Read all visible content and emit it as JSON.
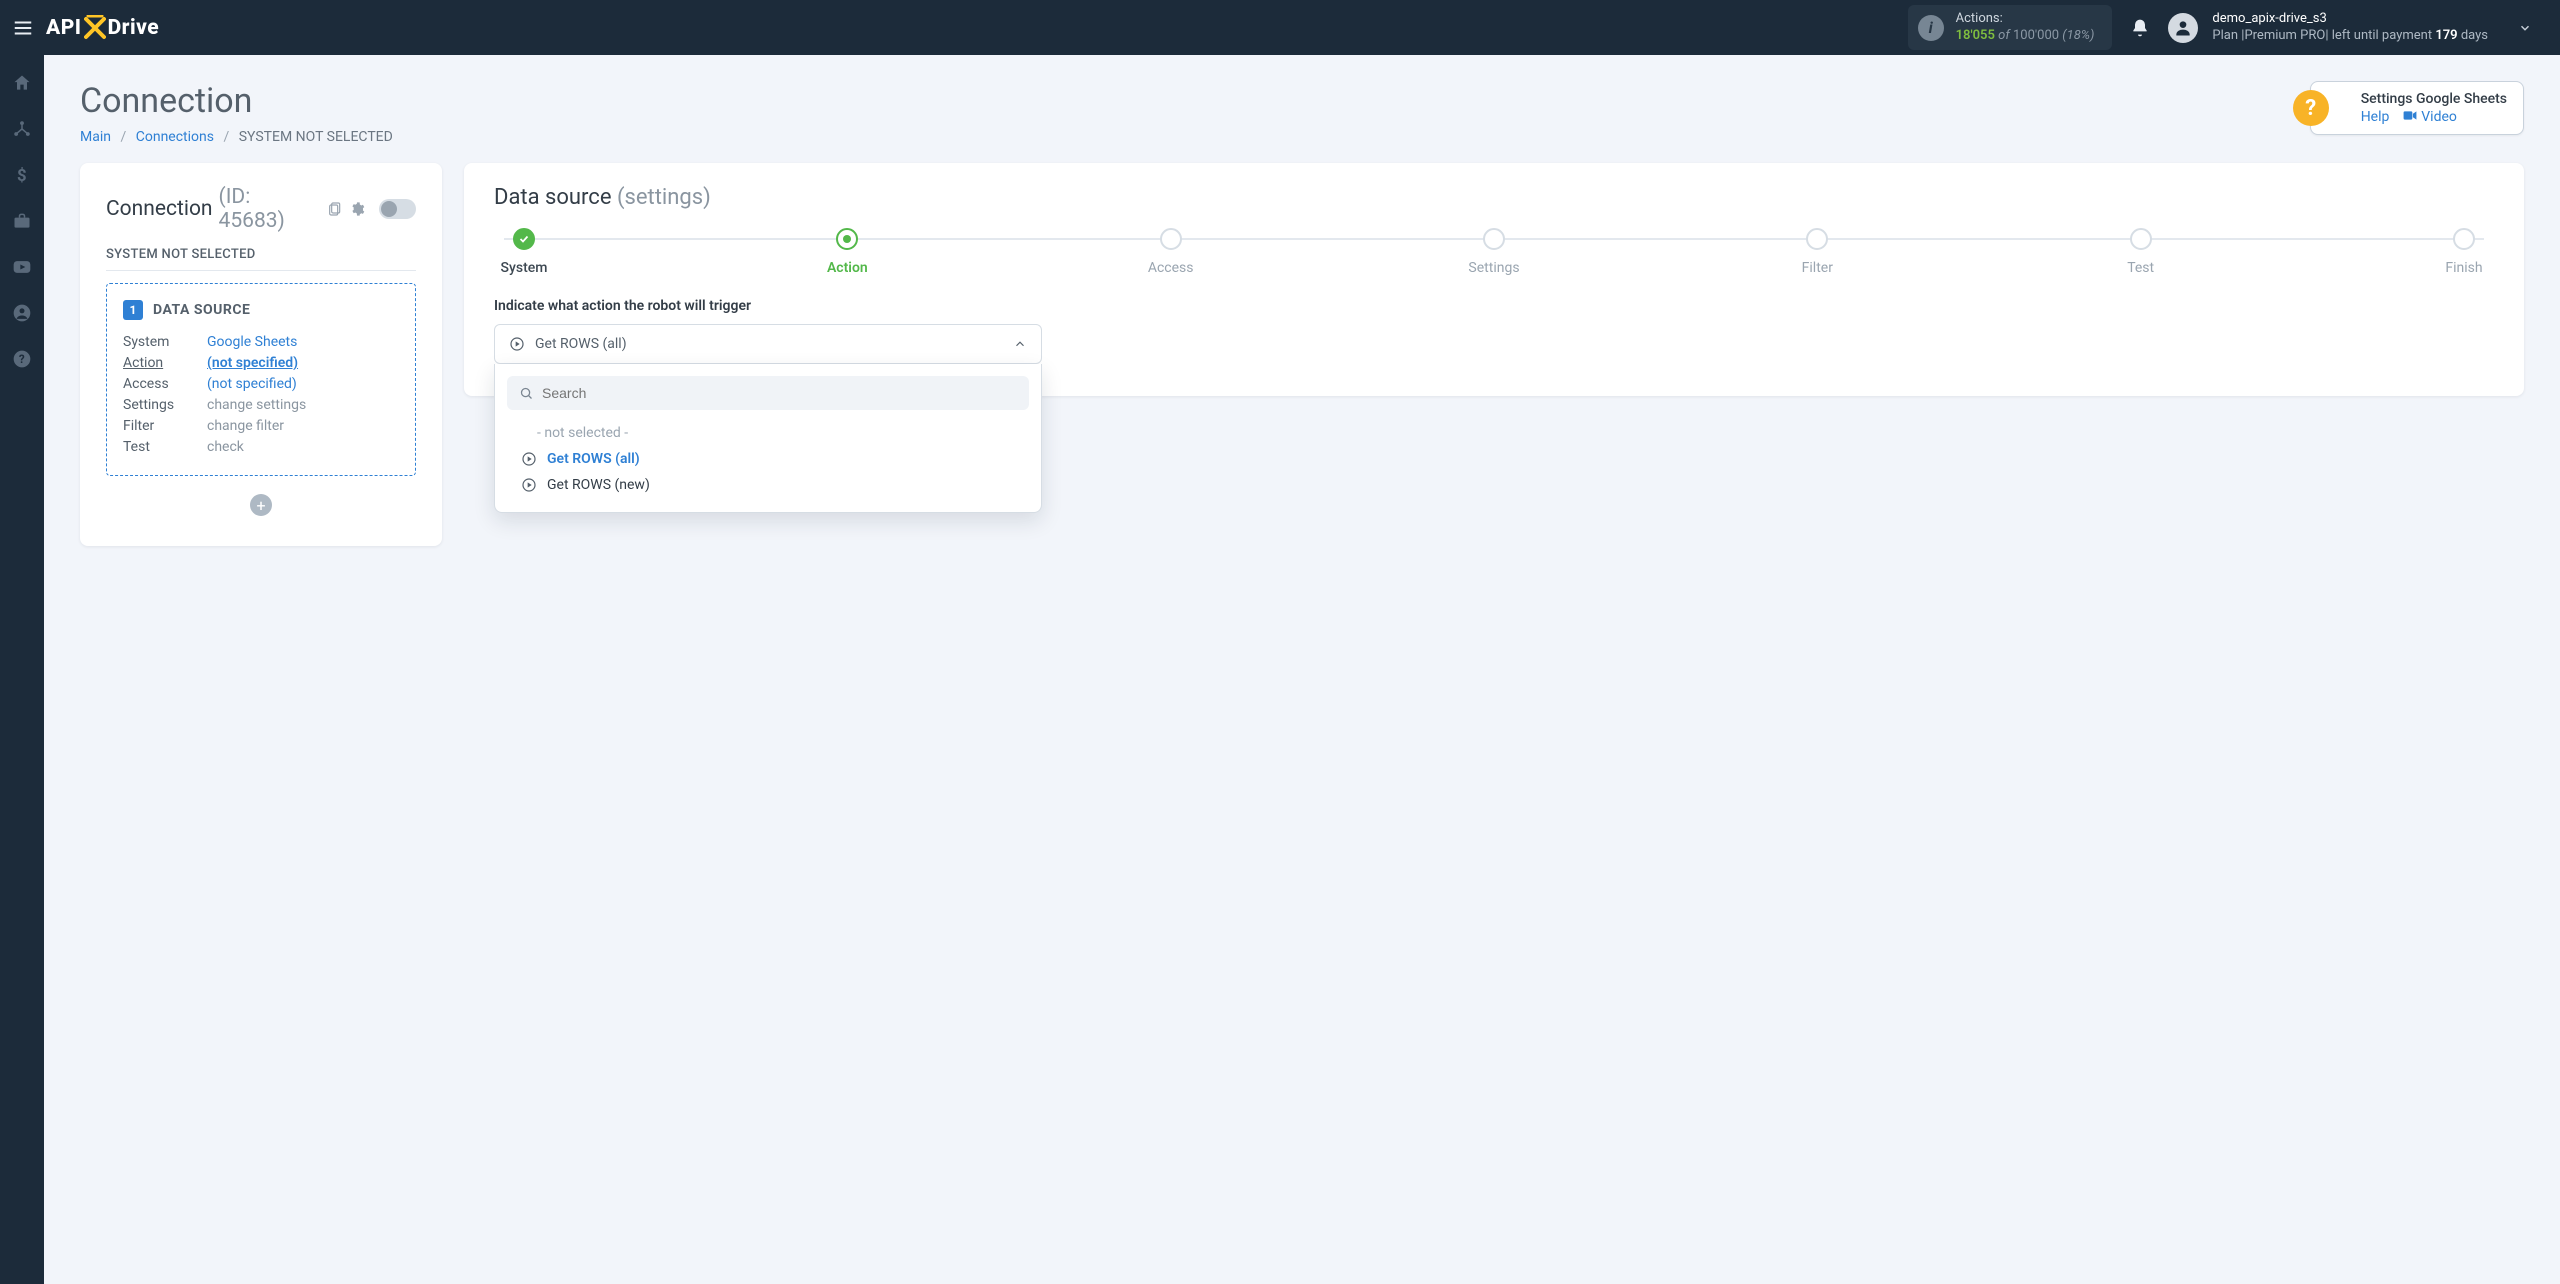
{
  "brand": {
    "part1": "API",
    "part2": "Drive"
  },
  "actions_box": {
    "label": "Actions:",
    "used": "18'055",
    "of": "of",
    "total": "100'000",
    "pct": "(18%)"
  },
  "user": {
    "name": "demo_apix-drive_s3",
    "plan_prefix": "Plan |",
    "plan_name": "Premium PRO",
    "plan_mid": "| left until payment ",
    "days": "179",
    "days_suffix": " days"
  },
  "page": {
    "title": "Connection",
    "breadcrumb": {
      "main": "Main",
      "connections": "Connections",
      "current": "SYSTEM NOT SELECTED"
    }
  },
  "help": {
    "title": "Settings Google Sheets",
    "help_link": "Help",
    "video_link": "Video"
  },
  "left_panel": {
    "title": "Connection",
    "id_label": "(ID: 45683)",
    "subhead": "SYSTEM NOT SELECTED",
    "data_source_label": "DATA SOURCE",
    "badge": "1",
    "rows": {
      "system_k": "System",
      "system_v": "Google Sheets",
      "action_k": "Action",
      "action_v": "(not specified)",
      "access_k": "Access",
      "access_v": "(not specified)",
      "settings_k": "Settings",
      "settings_v": "change settings",
      "filter_k": "Filter",
      "filter_v": "change filter",
      "test_k": "Test",
      "test_v": "check"
    }
  },
  "right_panel": {
    "title": "Data source",
    "title_sub": "(settings)",
    "steps": {
      "s1": "System",
      "s2": "Action",
      "s3": "Access",
      "s4": "Settings",
      "s5": "Filter",
      "s6": "Test",
      "s7": "Finish"
    },
    "instruct": "Indicate what action the robot will trigger",
    "selected_value": "Get ROWS (all)",
    "search_placeholder": "Search",
    "options": {
      "placeholder": "- not selected -",
      "o1": "Get ROWS (all)",
      "o2": "Get ROWS (new)"
    }
  }
}
